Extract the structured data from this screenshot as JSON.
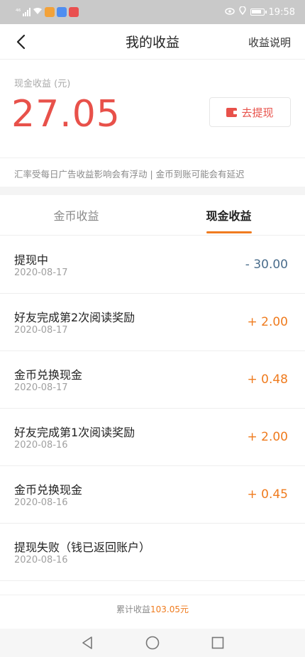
{
  "status_bar": {
    "signal_text": "⁴⁶",
    "time": "19:58",
    "icons": [
      "signal-icon",
      "wifi-icon",
      "app-badge-icon",
      "app-badge-icon",
      "app-badge-icon",
      "eye-icon",
      "location-icon",
      "battery-icon"
    ]
  },
  "nav": {
    "title": "我的收益",
    "right_label": "收益说明",
    "back_icon": "chevron-left-icon"
  },
  "summary": {
    "cash_label": "现金收益 (元)",
    "cash_amount": "27.05",
    "withdraw_label": "去提现",
    "withdraw_icon": "wallet-icon",
    "notice": "汇率受每日广告收益影响会有浮动 | 金币到账可能会有延迟"
  },
  "tabs": [
    {
      "label": "金币收益",
      "active": false
    },
    {
      "label": "现金收益",
      "active": true
    }
  ],
  "records": [
    {
      "title": "提现中",
      "date": "2020-08-17",
      "amount": "- 30.00",
      "type": "negative"
    },
    {
      "title": "好友完成第2次阅读奖励",
      "date": "2020-08-17",
      "amount": "+ 2.00",
      "type": "positive"
    },
    {
      "title": "金币兑换现金",
      "date": "2020-08-17",
      "amount": "+ 0.48",
      "type": "positive"
    },
    {
      "title": "好友完成第1次阅读奖励",
      "date": "2020-08-16",
      "amount": "+ 2.00",
      "type": "positive"
    },
    {
      "title": "金币兑换现金",
      "date": "2020-08-16",
      "amount": "+ 0.45",
      "type": "positive"
    },
    {
      "title": "提现失败（钱已返回账户）",
      "date": "2020-08-16",
      "amount": "",
      "type": "none"
    }
  ],
  "footer": {
    "total_label": "累计收益",
    "total_value": "103.05元"
  },
  "colors": {
    "accent_red": "#e8514a",
    "accent_orange": "#ef7b1e",
    "negative_blue": "#4a6d8c"
  }
}
